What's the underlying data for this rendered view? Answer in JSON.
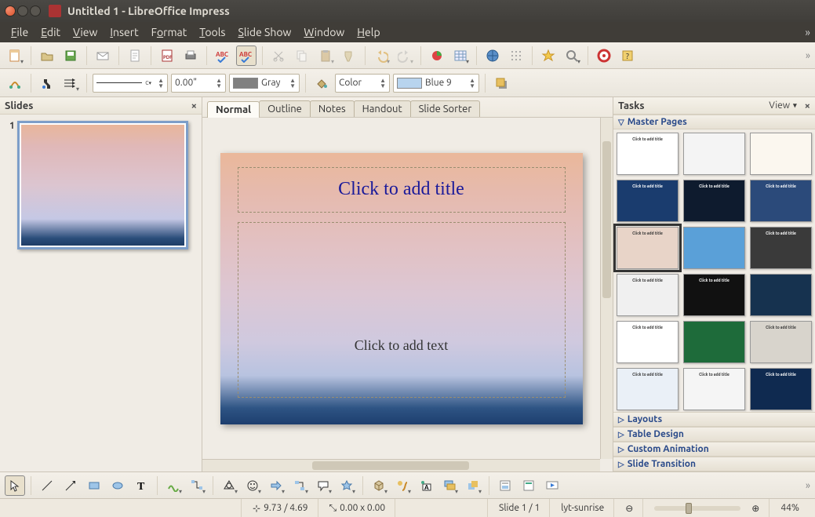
{
  "window": {
    "title": "Untitled 1 - LibreOffice Impress"
  },
  "menus": [
    "File",
    "Edit",
    "View",
    "Insert",
    "Format",
    "Tools",
    "Slide Show",
    "Window",
    "Help"
  ],
  "toolbar2": {
    "lineStyle": "———",
    "lineWidth": "0.00\"",
    "colorLabel": "Gray",
    "fillType": "Color",
    "fillColor": "Blue 9"
  },
  "slidesPanel": {
    "title": "Slides",
    "thumbs": [
      {
        "num": "1"
      }
    ]
  },
  "viewTabs": [
    "Normal",
    "Outline",
    "Notes",
    "Handout",
    "Slide Sorter"
  ],
  "slide": {
    "titlePlaceholder": "Click to add title",
    "bodyPlaceholder": "Click to add text"
  },
  "tasksPanel": {
    "title": "Tasks",
    "viewLabel": "View",
    "sections": [
      "Master Pages",
      "Layouts",
      "Table Design",
      "Custom Animation",
      "Slide Transition"
    ]
  },
  "masterThumbs": [
    {
      "bg": "#ffffff",
      "label": "Click to add title"
    },
    {
      "bg": "#f4f4f4",
      "label": ""
    },
    {
      "bg": "#fbf7ef",
      "label": ""
    },
    {
      "bg": "#1a3c6e",
      "label": "Click to add title",
      "dark": true
    },
    {
      "bg": "#0e1b2e",
      "label": "Click to add title",
      "dark": true
    },
    {
      "bg": "#2b4a7a",
      "label": "Click to add title",
      "dark": true
    },
    {
      "bg": "#e8d4c8",
      "label": "Click to add title",
      "selected": true
    },
    {
      "bg": "#5aa0d8",
      "label": ""
    },
    {
      "bg": "#3a3a3a",
      "label": "Click to add title",
      "dark": true
    },
    {
      "bg": "#f0f0f0",
      "label": "Click to add title"
    },
    {
      "bg": "#111111",
      "label": "Click to add title",
      "dark": true
    },
    {
      "bg": "#16324f",
      "label": "",
      "dark": true
    },
    {
      "bg": "#ffffff",
      "label": "Click to add title"
    },
    {
      "bg": "#1e6b3a",
      "label": "",
      "dark": true
    },
    {
      "bg": "#d8d4cc",
      "label": "Click to add title"
    },
    {
      "bg": "#eaf0f7",
      "label": "Click to add title"
    },
    {
      "bg": "#f5f5f5",
      "label": "Click to add title"
    },
    {
      "bg": "#0f2a50",
      "label": "Click to add title",
      "dark": true
    }
  ],
  "statusbar": {
    "pos": "9.73 / 4.69",
    "size": "0.00 x 0.00",
    "slide": "Slide 1 / 1",
    "template": "lyt-sunrise",
    "zoom": "44%"
  }
}
